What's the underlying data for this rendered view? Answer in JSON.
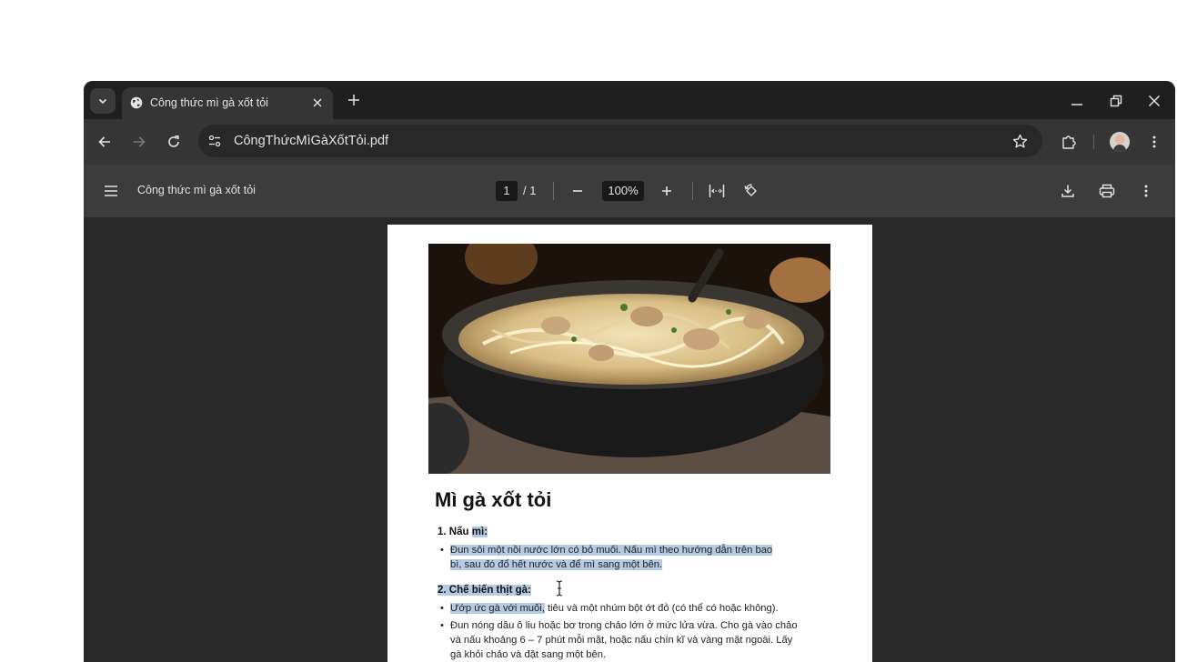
{
  "tab": {
    "title": "Công thức mì gà xốt tỏi"
  },
  "omnibox": {
    "url": "CôngThứcMìGàXốtTỏi.pdf"
  },
  "pdf_toolbar": {
    "title": "Công thức mì gà xốt tỏi",
    "current_page": "1",
    "page_total": "/ 1",
    "zoom": "100%"
  },
  "document": {
    "heading": "Mì gà xốt tỏi",
    "sections": [
      {
        "number": "1.",
        "title_plain": "Nấu ",
        "title_highlight": "mì:",
        "items": [
          {
            "line1": "Đun sôi một nồi nước lớn có bỏ muối. Nấu mì theo hướng dẫn trên bao",
            "line2": "bì, sau đó đổ hết nước và để mì sang một bên."
          }
        ]
      },
      {
        "title": "2. Chế biến thịt gà:",
        "items": [
          {
            "highlight": "Ướp ức gà với muối,",
            "rest": " tiêu và một nhúm bột ớt đỏ (có thể có hoặc không)."
          },
          {
            "line1": "Đun nóng dầu ô liu hoặc bơ trong chảo lớn ở mức lửa vừa. Cho gà vào chảo",
            "line2": "và nấu khoảng 6 – 7 phút mỗi mặt, hoặc nấu chín kĩ và vàng mặt ngoài. Lấy",
            "line3": "gà khỏi chảo và đặt sang một bên."
          }
        ]
      }
    ]
  },
  "colors": {
    "frame": "#1f1f1f",
    "toolbar": "#353535",
    "pdf_toolbar": "#3c3c3c",
    "viewer_bg": "#282828",
    "selection": "#b4cbe3"
  }
}
